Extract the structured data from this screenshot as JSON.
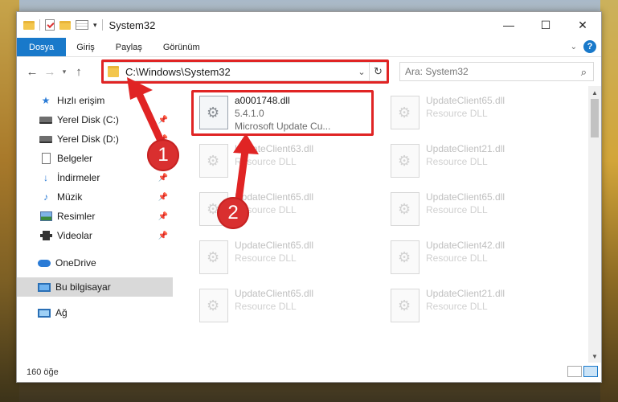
{
  "window": {
    "title": "System32",
    "controls": {
      "minimize": "—",
      "maximize": "☐",
      "close": "✕"
    }
  },
  "ribbon": {
    "tabs": [
      "Dosya",
      "Giriş",
      "Paylaş",
      "Görünüm"
    ],
    "help": "?",
    "expand": "⌄"
  },
  "address": {
    "path": "C:\\Windows\\System32",
    "search_placeholder": "Ara: System32"
  },
  "nav": {
    "items": [
      {
        "label": "Hızlı erişim",
        "icon": "star-icon"
      },
      {
        "label": "Yerel Disk (C:)",
        "icon": "disk-icon",
        "pinned": true
      },
      {
        "label": "Yerel Disk (D:)",
        "icon": "disk-icon",
        "pinned": true
      },
      {
        "label": "Belgeler",
        "icon": "document-icon",
        "pinned": true
      },
      {
        "label": "İndirmeler",
        "icon": "download-icon",
        "pinned": true
      },
      {
        "label": "Müzik",
        "icon": "music-icon",
        "pinned": true
      },
      {
        "label": "Resimler",
        "icon": "pictures-icon",
        "pinned": true
      },
      {
        "label": "Videolar",
        "icon": "videos-icon",
        "pinned": true
      },
      {
        "label": "OneDrive",
        "icon": "cloud-icon"
      },
      {
        "label": "Bu bilgisayar",
        "icon": "computer-icon",
        "selected": true
      },
      {
        "label": "Ağ",
        "icon": "network-icon"
      }
    ]
  },
  "files": [
    {
      "name": "a0001748.dll",
      "line2": "5.4.1.0",
      "line3": "Microsoft Update Cu..."
    },
    {
      "name": "UpdateClient65.dll",
      "line2": "Resource DLL"
    },
    {
      "name": "UpdateClient63.dll",
      "line2": "Resource DLL"
    },
    {
      "name": "UpdateClient21.dll",
      "line2": "Resource DLL"
    },
    {
      "name": "UpdateClient65.dll",
      "line2": "Resource DLL"
    },
    {
      "name": "UpdateClient65.dll",
      "line2": "Resource DLL"
    },
    {
      "name": "UpdateClient65.dll",
      "line2": "Resource DLL"
    },
    {
      "name": "UpdateClient42.dll",
      "line2": "Resource DLL"
    },
    {
      "name": "UpdateClient65.dll",
      "line2": "Resource DLL"
    },
    {
      "name": "UpdateClient21.dll",
      "line2": "Resource DLL"
    }
  ],
  "status": {
    "count": "160 öğe"
  },
  "annotations": {
    "badge1": "1",
    "badge2": "2",
    "color": "#e02424"
  }
}
